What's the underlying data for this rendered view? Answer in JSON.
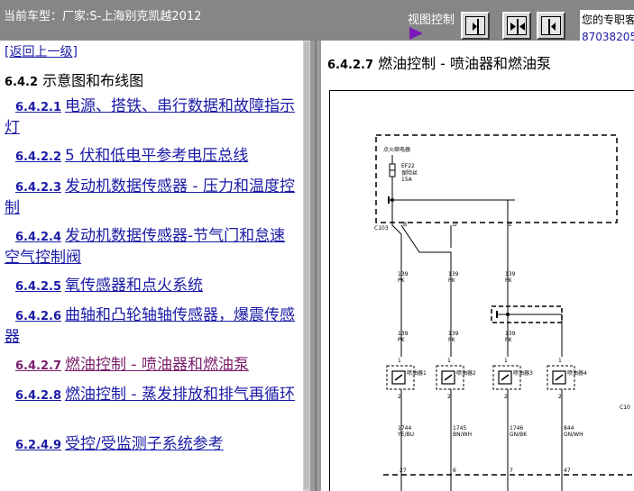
{
  "topbar": {
    "vehicle_label": "当前车型：厂家:S-上海别克凯越2012",
    "view_control_label": "视图控制",
    "contact_text": "您的专职客",
    "contact_phone": "87038205"
  },
  "left": {
    "back_link": "[返回上一级]",
    "section_num": "6.4.2",
    "section_title": "示意图和布线图",
    "items": [
      {
        "num": "6.4.2.1",
        "label": "电源、搭铁、串行数据和故障指示灯"
      },
      {
        "num": "6.4.2.2",
        "label": "5 伏和低电平参考电压总线"
      },
      {
        "num": "6.4.2.3",
        "label": "发动机数据传感器 - 压力和温度控制"
      },
      {
        "num": "6.4.2.4",
        "label": "发动机数据传感器-节气门和怠速空气控制阀"
      },
      {
        "num": "6.4.2.5",
        "label": "氧传感器和点火系统"
      },
      {
        "num": "6.4.2.6",
        "label": "曲轴和凸轮轴轴传感器，爆震传感器"
      },
      {
        "num": "6.4.2.7",
        "label": "燃油控制 - 喷油器和燃油泵"
      },
      {
        "num": "6.4.2.8",
        "label": "燃油控制 - 蒸发排放和排气再循环"
      },
      {
        "num": "6.2.4.9",
        "label": "受控/受监测子系统参考"
      }
    ]
  },
  "right": {
    "title_num": "6.4.2.7",
    "title": "燃油控制 - 喷油器和燃油泵"
  },
  "diagram": {
    "relay_box_label": "点火继电器",
    "fuse_id": "EF22",
    "fuse_name": "保险丝",
    "fuse_rating": "15A",
    "connector_c103": "C103",
    "connector_c10": "C10",
    "wires": [
      {
        "num": "139",
        "color": "PK"
      },
      {
        "num": "139",
        "color": "PK"
      },
      {
        "num": "139",
        "color": "PK"
      },
      {
        "num": "139",
        "color": "PK"
      },
      {
        "num": "139",
        "color": "PK"
      },
      {
        "num": "139",
        "color": "PK"
      }
    ],
    "injectors": [
      "喷油器1",
      "喷油器2",
      "喷油器3",
      "喷油器4"
    ],
    "control_wires": [
      {
        "num": "1744",
        "color": "YE/BU"
      },
      {
        "num": "1745",
        "color": "BN/WH"
      },
      {
        "num": "1746",
        "color": "GN/BK"
      },
      {
        "num": "844",
        "color": "GN/WH"
      }
    ],
    "pin_1": "1",
    "pin_2": "2",
    "pin_b": "B",
    "pin_d": "D",
    "pin_e": "E",
    "bottom_pins": [
      "27",
      "6",
      "7",
      "47"
    ]
  },
  "colors": {
    "topbar": "#868686",
    "link": "#1a1aa6",
    "visited": "#7a1e6b",
    "view_arrow": "#7a1ab8"
  }
}
